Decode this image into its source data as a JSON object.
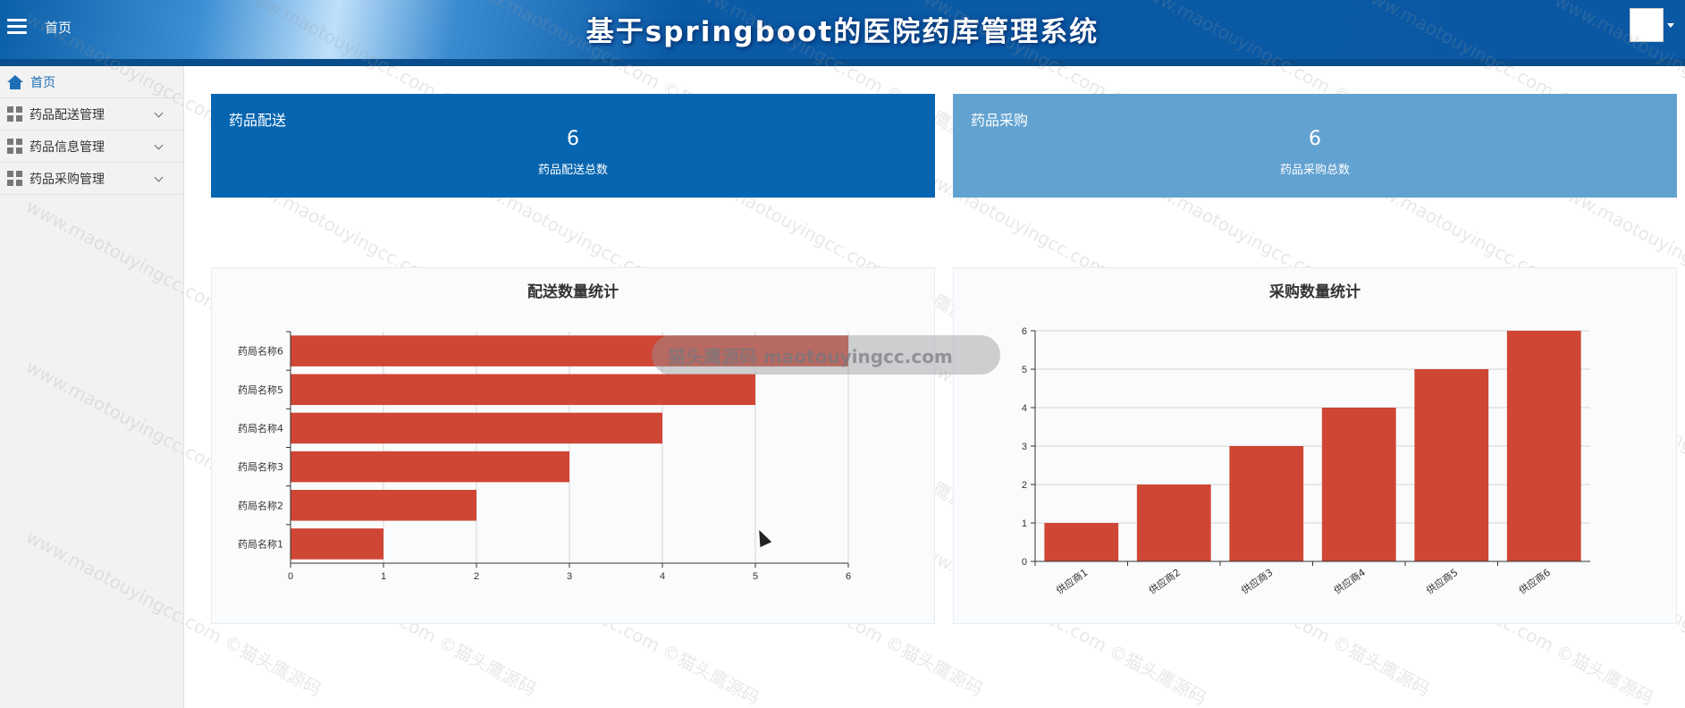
{
  "header": {
    "home_label": "首页",
    "title": "基于springboot的医院药库管理系统"
  },
  "sidebar": {
    "items": [
      {
        "label": "首页",
        "icon": "home-icon"
      },
      {
        "label": "药品配送管理",
        "icon": "grid-icon"
      },
      {
        "label": "药品信息管理",
        "icon": "grid-icon"
      },
      {
        "label": "药品采购管理",
        "icon": "grid-icon"
      }
    ]
  },
  "cards": [
    {
      "title": "药品配送",
      "value": "6",
      "subtitle": "药品配送总数",
      "color": "#0565b0"
    },
    {
      "title": "药品采购",
      "value": "6",
      "subtitle": "药品采购总数",
      "color": "#62a2d0"
    }
  ],
  "overlay": {
    "text": "猫头鹰源码 maotouyingcc.com"
  },
  "watermark": {
    "text": "www.maotouyingcc.com ©猫头鹰源码"
  },
  "chart_data": [
    {
      "type": "bar",
      "orientation": "horizontal",
      "title": "配送数量统计",
      "categories": [
        "药局名称1",
        "药局名称2",
        "药局名称3",
        "药局名称4",
        "药局名称5",
        "药局名称6"
      ],
      "values": [
        1,
        2,
        3,
        4,
        5,
        6
      ],
      "xlim": [
        0,
        6
      ],
      "xticks": [
        "0",
        "1",
        "2",
        "3",
        "4",
        "5",
        "6"
      ],
      "color": "#cf4634",
      "grid": true
    },
    {
      "type": "bar",
      "orientation": "vertical",
      "title": "采购数量统计",
      "categories": [
        "供应商1",
        "供应商2",
        "供应商3",
        "供应商4",
        "供应商5",
        "供应商6"
      ],
      "values": [
        1,
        2,
        3,
        4,
        5,
        6
      ],
      "ylim": [
        0,
        6
      ],
      "yticks": [
        "0",
        "1",
        "2",
        "3",
        "4",
        "5",
        "6"
      ],
      "color": "#cf4634",
      "grid": true
    }
  ]
}
